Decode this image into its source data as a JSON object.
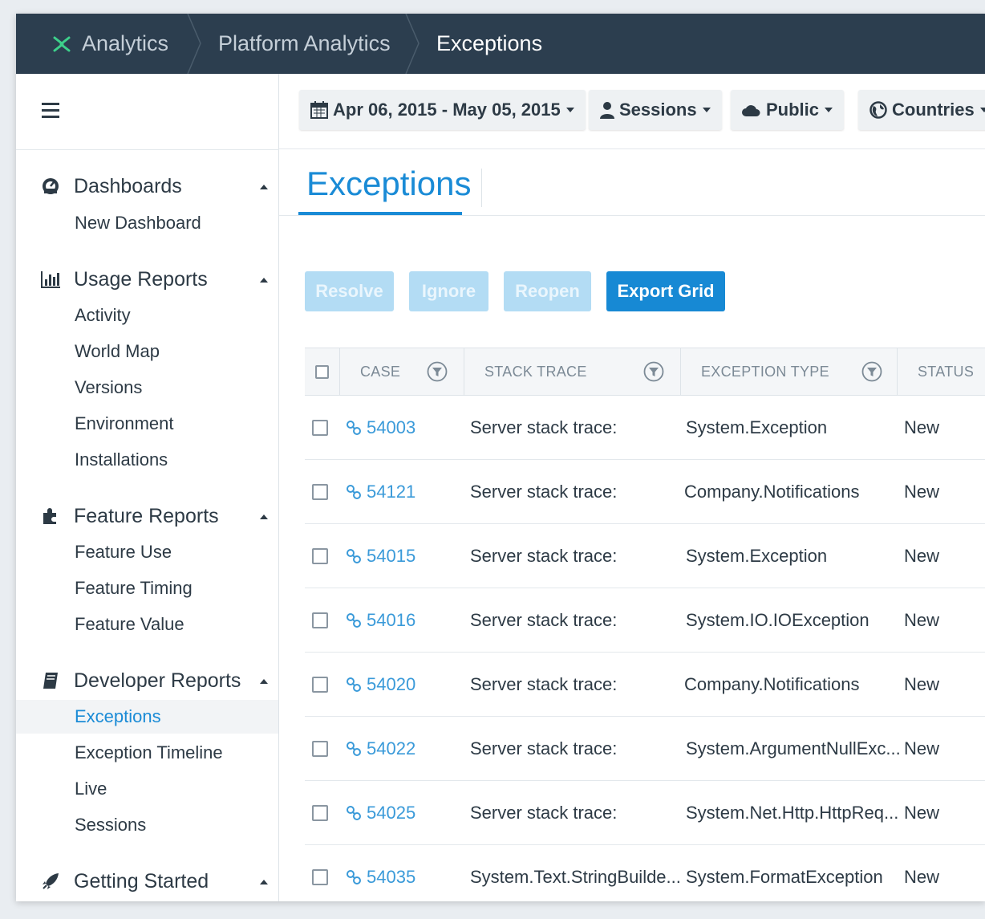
{
  "breadcrumbs": [
    {
      "label": "Analytics"
    },
    {
      "label": "Platform Analytics"
    },
    {
      "label": "Exceptions"
    }
  ],
  "filters": {
    "date_range": "Apr 06, 2015 - May 05, 2015",
    "metric": "Sessions",
    "scope": "Public",
    "region": "Countries"
  },
  "sidebar": {
    "sections": [
      {
        "title": "Dashboards",
        "icon": "dashboard-icon",
        "items": [
          "New Dashboard"
        ]
      },
      {
        "title": "Usage Reports",
        "icon": "bar-chart-icon",
        "items": [
          "Activity",
          "World Map",
          "Versions",
          "Environment",
          "Installations"
        ]
      },
      {
        "title": "Feature Reports",
        "icon": "puzzle-icon",
        "items": [
          "Feature Use",
          "Feature Timing",
          "Feature Value"
        ]
      },
      {
        "title": "Developer Reports",
        "icon": "book-icon",
        "items": [
          "Exceptions",
          "Exception Timeline",
          "Live",
          "Sessions"
        ]
      },
      {
        "title": "Getting Started",
        "icon": "rocket-icon",
        "items": []
      }
    ],
    "active_item": "Exceptions"
  },
  "main": {
    "title": "Exceptions",
    "actions": {
      "resolve": "Resolve",
      "ignore": "Ignore",
      "reopen": "Reopen",
      "export": "Export Grid"
    },
    "table": {
      "columns": [
        "CASE",
        "STACK TRACE",
        "EXCEPTION TYPE",
        "STATUS"
      ],
      "rows": [
        {
          "case": "54003",
          "stack_trace": "Server stack trace:",
          "exception_type": "System.Exception",
          "status": "New"
        },
        {
          "case": "54121",
          "stack_trace": "Server stack trace:",
          "exception_type": "Company.Notifications",
          "status": "New"
        },
        {
          "case": "54015",
          "stack_trace": "Server stack trace:",
          "exception_type": "System.Exception",
          "status": "New"
        },
        {
          "case": "54016",
          "stack_trace": "Server stack trace:",
          "exception_type": "System.IO.IOException",
          "status": "New"
        },
        {
          "case": "54020",
          "stack_trace": "Server stack trace:",
          "exception_type": "Company.Notifications",
          "status": "New"
        },
        {
          "case": "54022",
          "stack_trace": "Server stack trace:",
          "exception_type": "System.ArgumentNullExc...",
          "status": "New"
        },
        {
          "case": "54025",
          "stack_trace": "Server stack trace:",
          "exception_type": "System.Net.Http.HttpReq...",
          "status": "New"
        },
        {
          "case": "54035",
          "stack_trace": "System.Text.StringBuilde...",
          "exception_type": "System.FormatException",
          "status": "New"
        }
      ]
    }
  },
  "colors": {
    "topbar": "#2c3e4f",
    "accent": "#1a8bd6",
    "logo": "#3dd08b"
  }
}
